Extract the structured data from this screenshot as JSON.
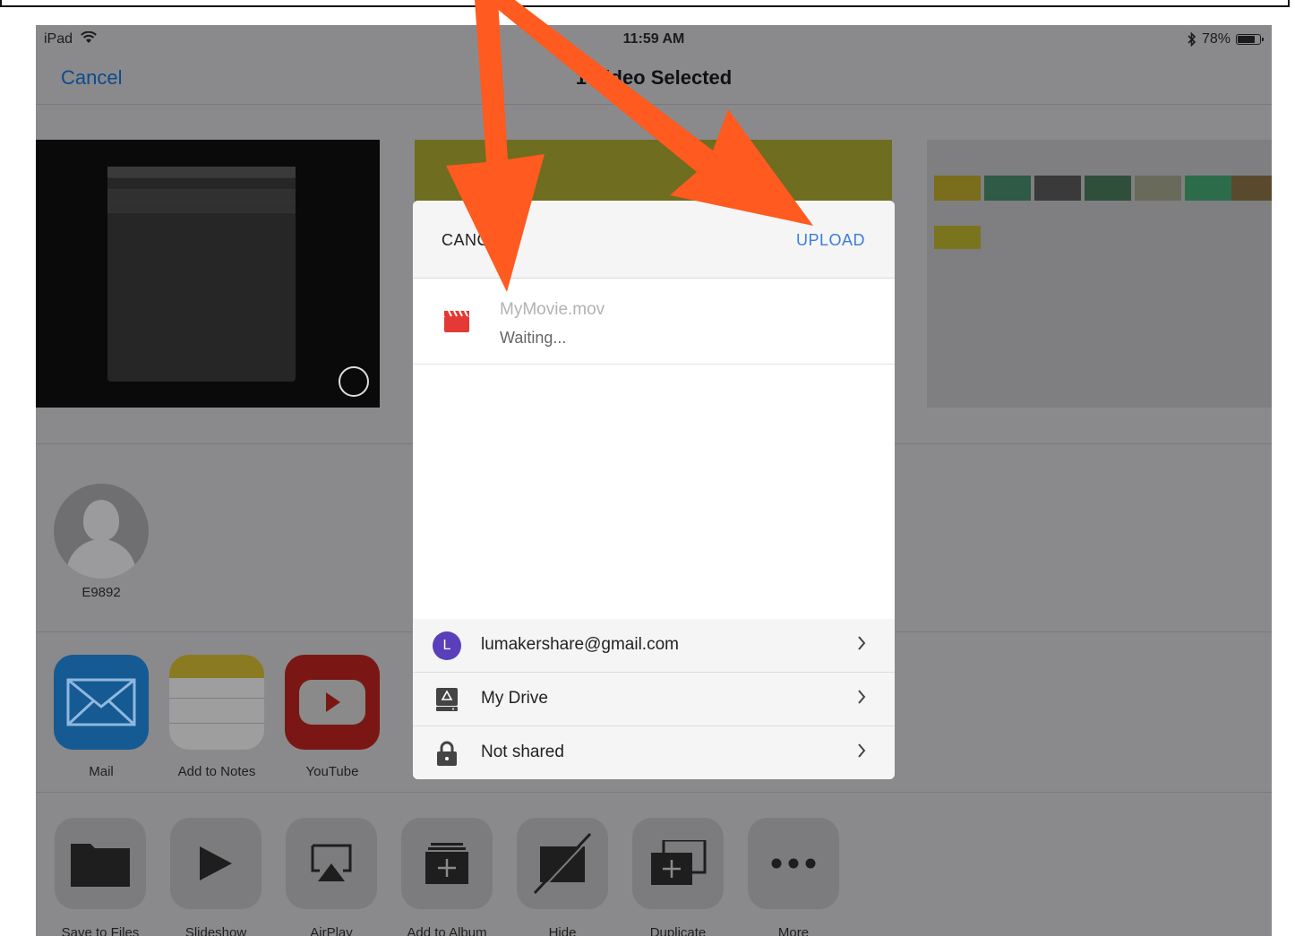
{
  "status_bar": {
    "device": "iPad",
    "time": "11:59 AM",
    "battery": "78%",
    "battery_level": 0.78
  },
  "nav": {
    "cancel_label": "Cancel",
    "title": "1 Video Selected"
  },
  "contact": {
    "name": "E9892"
  },
  "apps": [
    {
      "label": "Mail",
      "icon": "mail-icon"
    },
    {
      "label": "Add to Notes",
      "icon": "notes-icon"
    },
    {
      "label": "YouTube",
      "icon": "youtube-icon"
    }
  ],
  "actions": [
    {
      "label": "Save to Files",
      "icon": "folder-icon"
    },
    {
      "label": "Slideshow",
      "icon": "play-icon"
    },
    {
      "label": "AirPlay",
      "icon": "airplay-icon"
    },
    {
      "label": "Add to Album",
      "icon": "add-album-icon"
    },
    {
      "label": "Hide",
      "icon": "hide-icon"
    },
    {
      "label": "Duplicate",
      "icon": "duplicate-icon"
    },
    {
      "label": "More",
      "icon": "more-icon"
    }
  ],
  "dialog": {
    "cancel_label": "CANCEL",
    "upload_label": "UPLOAD",
    "file": {
      "name": "MyMovie.mov",
      "status": "Waiting..."
    },
    "settings": [
      {
        "label": "lumakershare@gmail.com",
        "icon": "account-avatar-icon",
        "avatar_letter": "L"
      },
      {
        "label": "My Drive",
        "icon": "drive-icon"
      },
      {
        "label": "Not shared",
        "icon": "lock-icon"
      }
    ]
  },
  "colors": {
    "accent_blue": "#3c7ddc",
    "arrow_orange": "#ff5a1f",
    "dim_overlay": "#8a8a8c"
  }
}
